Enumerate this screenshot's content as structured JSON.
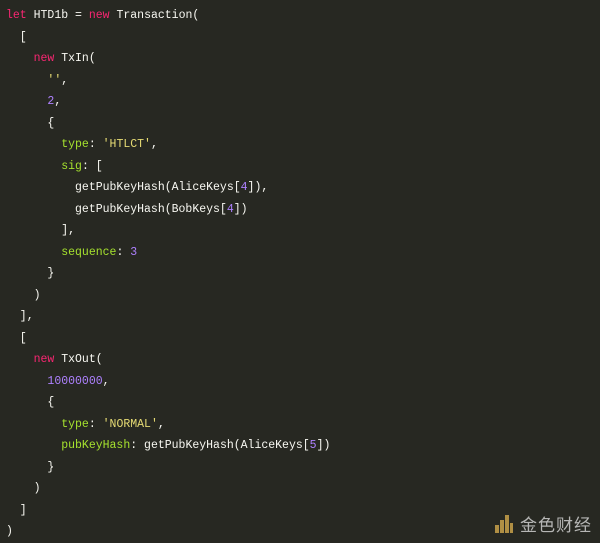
{
  "code": {
    "lines": [
      [
        {
          "t": "kw",
          "v": "let"
        },
        {
          "t": "txt",
          "v": " HTD1b = "
        },
        {
          "t": "kw",
          "v": "new"
        },
        {
          "t": "txt",
          "v": " Transaction("
        }
      ],
      [
        {
          "t": "txt",
          "v": "  ["
        }
      ],
      [
        {
          "t": "txt",
          "v": "    "
        },
        {
          "t": "kw",
          "v": "new"
        },
        {
          "t": "txt",
          "v": " TxIn("
        }
      ],
      [
        {
          "t": "txt",
          "v": "      "
        },
        {
          "t": "str",
          "v": "''"
        },
        {
          "t": "txt",
          "v": ","
        }
      ],
      [
        {
          "t": "txt",
          "v": "      "
        },
        {
          "t": "num",
          "v": "2"
        },
        {
          "t": "txt",
          "v": ","
        }
      ],
      [
        {
          "t": "txt",
          "v": "      {"
        }
      ],
      [
        {
          "t": "txt",
          "v": "        "
        },
        {
          "t": "prop",
          "v": "type"
        },
        {
          "t": "txt",
          "v": ": "
        },
        {
          "t": "str",
          "v": "'HTLCT'"
        },
        {
          "t": "txt",
          "v": ","
        }
      ],
      [
        {
          "t": "txt",
          "v": "        "
        },
        {
          "t": "prop",
          "v": "sig"
        },
        {
          "t": "txt",
          "v": ": ["
        }
      ],
      [
        {
          "t": "txt",
          "v": "          getPubKeyHash(AliceKeys["
        },
        {
          "t": "num",
          "v": "4"
        },
        {
          "t": "txt",
          "v": "]),"
        }
      ],
      [
        {
          "t": "txt",
          "v": "          getPubKeyHash(BobKeys["
        },
        {
          "t": "num",
          "v": "4"
        },
        {
          "t": "txt",
          "v": "])"
        }
      ],
      [
        {
          "t": "txt",
          "v": "        ],"
        }
      ],
      [
        {
          "t": "txt",
          "v": "        "
        },
        {
          "t": "prop",
          "v": "sequence"
        },
        {
          "t": "txt",
          "v": ": "
        },
        {
          "t": "num",
          "v": "3"
        }
      ],
      [
        {
          "t": "txt",
          "v": "      }"
        }
      ],
      [
        {
          "t": "txt",
          "v": "    )"
        }
      ],
      [
        {
          "t": "txt",
          "v": "  ],"
        }
      ],
      [
        {
          "t": "txt",
          "v": "  ["
        }
      ],
      [
        {
          "t": "txt",
          "v": "    "
        },
        {
          "t": "kw",
          "v": "new"
        },
        {
          "t": "txt",
          "v": " TxOut("
        }
      ],
      [
        {
          "t": "txt",
          "v": "      "
        },
        {
          "t": "num",
          "v": "10000000"
        },
        {
          "t": "txt",
          "v": ","
        }
      ],
      [
        {
          "t": "txt",
          "v": "      {"
        }
      ],
      [
        {
          "t": "txt",
          "v": "        "
        },
        {
          "t": "prop",
          "v": "type"
        },
        {
          "t": "txt",
          "v": ": "
        },
        {
          "t": "str",
          "v": "'NORMAL'"
        },
        {
          "t": "txt",
          "v": ","
        }
      ],
      [
        {
          "t": "txt",
          "v": "        "
        },
        {
          "t": "prop",
          "v": "pubKeyHash"
        },
        {
          "t": "txt",
          "v": ": getPubKeyHash(AliceKeys["
        },
        {
          "t": "num",
          "v": "5"
        },
        {
          "t": "txt",
          "v": "])"
        }
      ],
      [
        {
          "t": "txt",
          "v": "      }"
        }
      ],
      [
        {
          "t": "txt",
          "v": "    )"
        }
      ],
      [
        {
          "t": "txt",
          "v": "  ]"
        }
      ],
      [
        {
          "t": "txt",
          "v": ")"
        }
      ]
    ]
  },
  "watermark": {
    "text": "金色财经",
    "icon": "jinse-logo-icon"
  },
  "colors": {
    "background": "#272822",
    "keyword": "#f92672",
    "property": "#a6e22e",
    "string": "#e6db74",
    "number": "#ae81ff",
    "text": "#f8f8f2"
  }
}
